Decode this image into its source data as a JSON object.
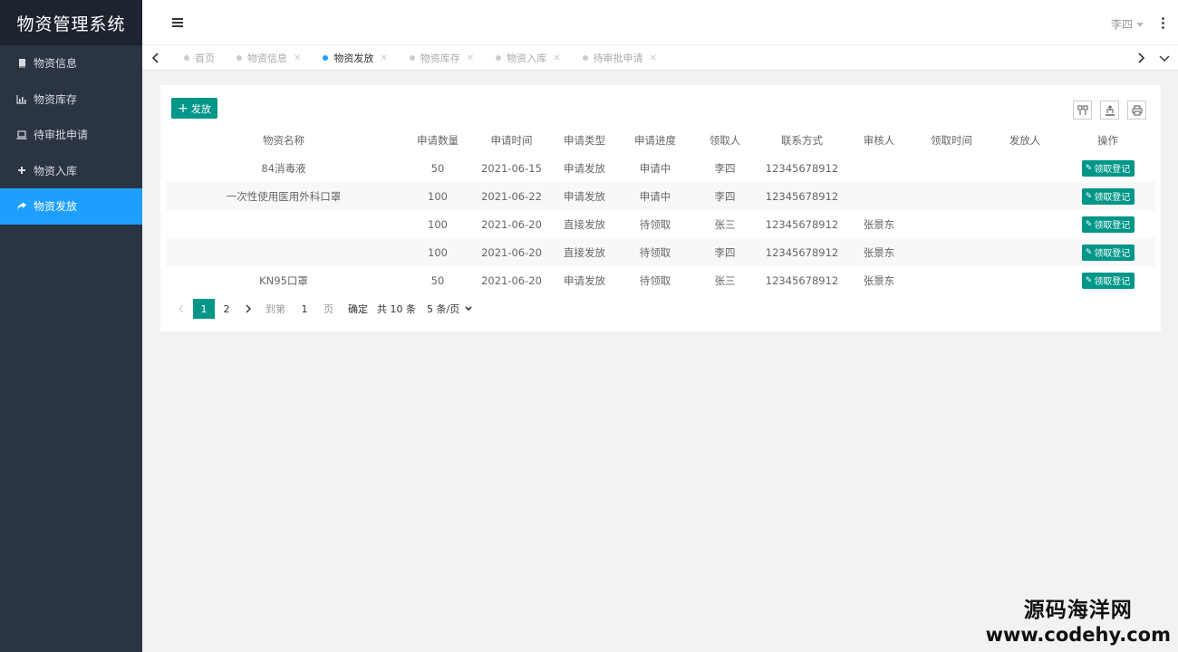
{
  "app": {
    "title": "物资管理系统"
  },
  "sidebar": {
    "items": [
      {
        "label": "物资信息",
        "icon": "book-icon"
      },
      {
        "label": "物资库存",
        "icon": "bar-chart-icon"
      },
      {
        "label": "待审批申请",
        "icon": "laptop-icon"
      },
      {
        "label": "物资入库",
        "icon": "plus-icon"
      },
      {
        "label": "物资发放",
        "icon": "share-icon",
        "active": true
      }
    ]
  },
  "header": {
    "user": "李四"
  },
  "tabs": [
    {
      "label": "首页"
    },
    {
      "label": "物资信息"
    },
    {
      "label": "物资发放",
      "active": true
    },
    {
      "label": "物资库存"
    },
    {
      "label": "物资入库"
    },
    {
      "label": "待审批申请"
    }
  ],
  "toolbar": {
    "add_label": "发放"
  },
  "table": {
    "columns": [
      "物资名称",
      "申请数量",
      "申请时间",
      "申请类型",
      "申请进度",
      "领取人",
      "联系方式",
      "审核人",
      "领取时间",
      "发放人",
      "操作"
    ],
    "action_label": "领取登记",
    "rows": [
      {
        "name": "84消毒液",
        "qty": "50",
        "date": "2021-06-15",
        "type": "申请发放",
        "progress": "申请中",
        "receiver": "李四",
        "contact": "12345678912",
        "reviewer": "",
        "receive_time": "",
        "issuer": ""
      },
      {
        "name": "一次性使用医用外科口罩",
        "qty": "100",
        "date": "2021-06-22",
        "type": "申请发放",
        "progress": "申请中",
        "receiver": "李四",
        "contact": "12345678912",
        "reviewer": "",
        "receive_time": "",
        "issuer": ""
      },
      {
        "name": "",
        "qty": "100",
        "date": "2021-06-20",
        "type": "直接发放",
        "progress": "待领取",
        "receiver": "张三",
        "contact": "12345678912",
        "reviewer": "张景东",
        "receive_time": "",
        "issuer": ""
      },
      {
        "name": "",
        "qty": "100",
        "date": "2021-06-20",
        "type": "直接发放",
        "progress": "待领取",
        "receiver": "李四",
        "contact": "12345678912",
        "reviewer": "张景东",
        "receive_time": "",
        "issuer": ""
      },
      {
        "name": "KN95口罩",
        "qty": "50",
        "date": "2021-06-20",
        "type": "申请发放",
        "progress": "待领取",
        "receiver": "张三",
        "contact": "12345678912",
        "reviewer": "张景东",
        "receive_time": "",
        "issuer": ""
      }
    ]
  },
  "pager": {
    "current": "1",
    "next_page": "2",
    "goto_label": "到第",
    "goto_value": "1",
    "page_unit": "页",
    "confirm": "确定",
    "total": "共 10 条",
    "page_size": "5 条/页"
  },
  "watermark": {
    "line1": "源码海洋网",
    "line2": "www.codehy.com"
  },
  "colors": {
    "sidebar_bg": "#2b3442",
    "accent_blue": "#1e9fff",
    "accent_green": "#009688"
  }
}
